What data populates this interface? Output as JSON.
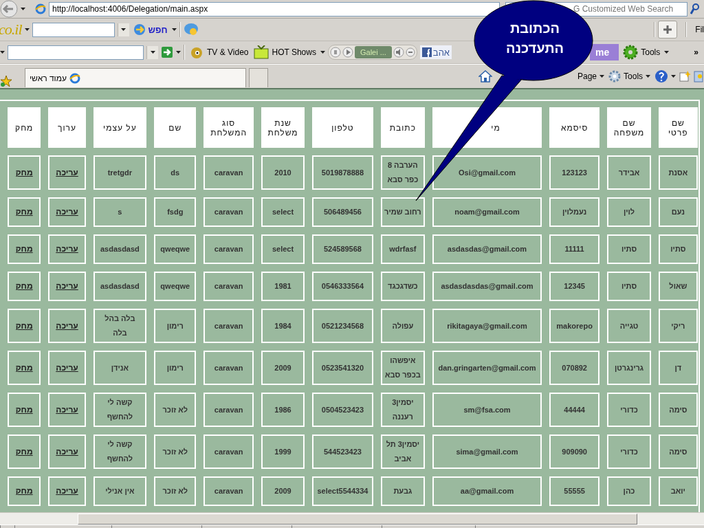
{
  "browser": {
    "address": {
      "url": "http://localhost:4006/Delegation/main.aspx"
    },
    "search": {
      "placeholder": "G Customized Web Search"
    },
    "toolbar_1": {
      "logo": "co.il",
      "search_label": "חפש",
      "menu_label": "Fil"
    },
    "toolbar_2": {
      "video_button": "TV & Video",
      "shows_button": "HOT Shows",
      "player": {
        "station": "Galei ..."
      },
      "facebook_label": "אהב",
      "purple_label": "me",
      "tools": "Tools",
      "more": "»"
    },
    "tabs": [
      {
        "label": "עמוד ראשי",
        "selected": true
      }
    ],
    "command_bar": {
      "page_menu": "Page",
      "tools_menu": "Tools"
    }
  },
  "table": {
    "columns": [
      "שם פרטי",
      "שם משפחה",
      "סיסמא",
      "מי",
      "כתובת",
      "טלפון",
      "שנת משלחת",
      "סוג המשלחת",
      "שם",
      "על עצמי",
      "ערוך",
      "מחק"
    ],
    "rows": [
      {
        "cells": [
          "אסנת",
          "אבידר",
          "123123",
          "Osi@gmail.com",
          "הערבה 8 כפר סבא",
          "5019878888",
          "2010",
          "caravan",
          "ds",
          "tretgdr"
        ],
        "edit": "עריכה",
        "delete": "מחק"
      },
      {
        "cells": [
          "נעם",
          "לוין",
          "נעמלוין",
          "noam@gmail.com",
          "רחוב שמיר",
          "506489456",
          "select",
          "caravan",
          "fsdg",
          "s"
        ],
        "edit": "עריכה",
        "delete": "מחק"
      },
      {
        "cells": [
          "סתיו",
          "סתיו",
          "11111",
          "asdasdas@gmail.com",
          "wdrfasf",
          "524589568",
          "select",
          "caravan",
          "qweqwe",
          "asdasdasd"
        ],
        "edit": "עריכה",
        "delete": "מחק"
      },
      {
        "cells": [
          "שאול",
          "סתיו",
          "12345",
          "asdasdasdas@gmail.com",
          "כשדגכגד",
          "0546333564",
          "1981",
          "caravan",
          "qweqwe",
          "asdasdasd"
        ],
        "edit": "עריכה",
        "delete": "מחק"
      },
      {
        "cells": [
          "ריקי",
          "טגייה",
          "makorepo",
          "rikitagaya@gmail.com",
          "עפולה",
          "0521234568",
          "1984",
          "caravan",
          "רימון",
          "בלה בהל בלה"
        ],
        "edit": "עריכה",
        "delete": "מחק"
      },
      {
        "cells": [
          "דן",
          "גרינגרטן",
          "070892",
          "dan.gringarten@gmail.com",
          "איפשהו בכפר סבא",
          "0523541320",
          "2009",
          "caravan",
          "רימון",
          "אנידן"
        ],
        "edit": "עריכה",
        "delete": "מחק"
      },
      {
        "cells": [
          "סימה",
          "כדורי",
          "44444",
          "sm@fsa.com",
          "יסמין3 רעננה",
          "0504523423",
          "1986",
          "caravan",
          "לא זוכר",
          "קשה לי להחשף"
        ],
        "edit": "עריכה",
        "delete": "מחק"
      },
      {
        "cells": [
          "סימה",
          "כדורי",
          "909090",
          "sima@gmail.com",
          "יסמין3 תל אביב",
          "544523423",
          "1999",
          "caravan",
          "לא זוכר",
          "קשה לי להחשף"
        ],
        "edit": "עריכה",
        "delete": "מחק"
      },
      {
        "cells": [
          "יואב",
          "כהן",
          "55555",
          "aa@gmail.com",
          "גבעת",
          "select5544334",
          "2009",
          "caravan",
          "לא זוכר",
          "אין אנילי"
        ],
        "edit": "עריכה",
        "delete": "מחק"
      }
    ]
  },
  "callout": {
    "lines": [
      "הכתובת",
      "התעדכנה"
    ]
  }
}
